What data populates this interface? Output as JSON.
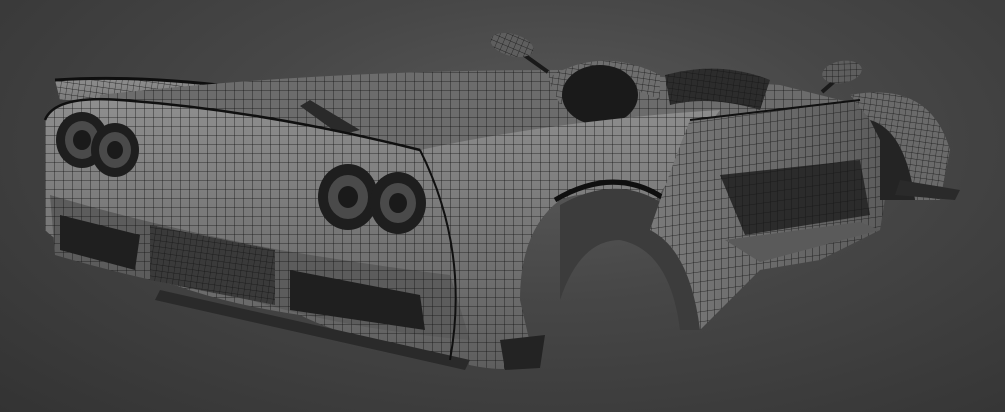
{
  "scene": {
    "subject": "car-body-wireframe",
    "background_color": "#454545",
    "shell_fill": "#7c7c7c",
    "shadow_fill": "#1c1c1c",
    "wire_color": "#111111"
  }
}
